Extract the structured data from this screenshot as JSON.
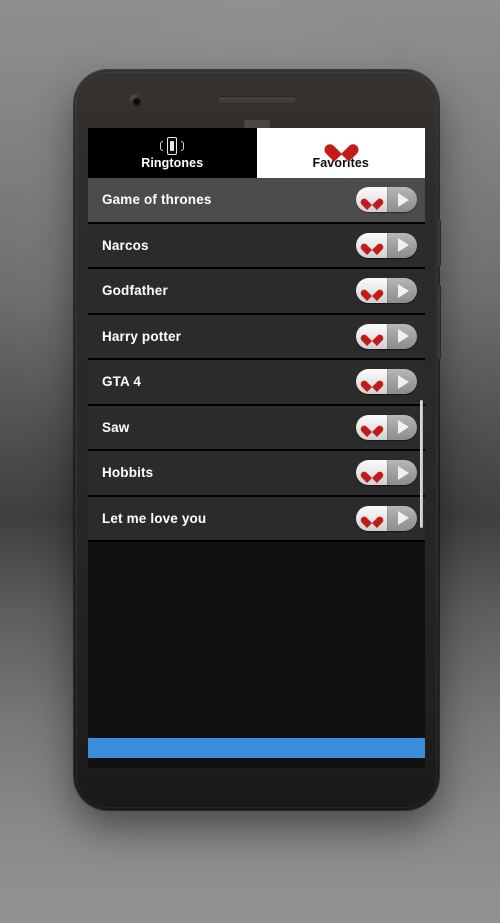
{
  "app": {
    "tabs": [
      {
        "label": "Ringtones",
        "icon": "vibrating-phone-icon",
        "active": false
      },
      {
        "label": "Favorites",
        "icon": "heart-icon",
        "active": true
      }
    ],
    "list": {
      "items": [
        {
          "title": "Game of thrones",
          "selected": true,
          "favorite_icon": "heart-icon",
          "play_icon": "play-icon"
        },
        {
          "title": "Narcos",
          "selected": false,
          "favorite_icon": "heart-icon",
          "play_icon": "play-icon"
        },
        {
          "title": "Godfather",
          "selected": false,
          "favorite_icon": "heart-icon",
          "play_icon": "play-icon"
        },
        {
          "title": "Harry potter",
          "selected": false,
          "favorite_icon": "heart-icon",
          "play_icon": "play-icon"
        },
        {
          "title": "GTA 4",
          "selected": false,
          "favorite_icon": "heart-icon",
          "play_icon": "play-icon"
        },
        {
          "title": "Saw",
          "selected": false,
          "favorite_icon": "heart-icon",
          "play_icon": "play-icon"
        },
        {
          "title": "Hobbits",
          "selected": false,
          "favorite_icon": "heart-icon",
          "play_icon": "play-icon"
        },
        {
          "title": "Let me love you",
          "selected": false,
          "favorite_icon": "heart-icon",
          "play_icon": "play-icon"
        }
      ]
    },
    "ad_banner": {
      "label": ""
    }
  },
  "device": {
    "front_camera": "camera-icon",
    "earpiece": "speaker-grille",
    "buttons": [
      "power-button",
      "volume-button"
    ]
  },
  "colors": {
    "tab_active_bg": "#ffffff",
    "tab_inactive_bg": "#000000",
    "row_bg": "#2b2b2b",
    "row_selected_bg": "#4c4c4c",
    "heart_red": "#c21b1b",
    "ad_blue": "#3a8ddb",
    "screen_bg": "#111111"
  }
}
